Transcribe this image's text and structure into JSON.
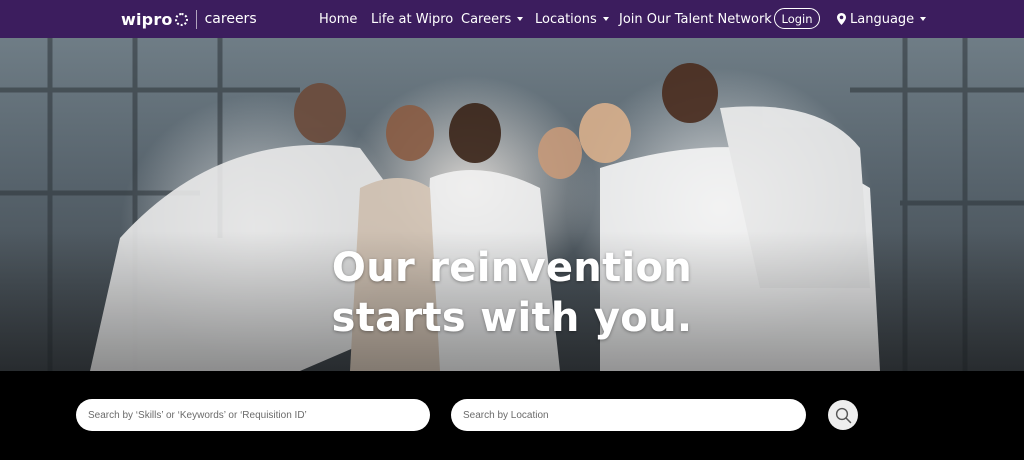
{
  "brand": {
    "logo_text": "wipro",
    "section": "careers"
  },
  "nav": {
    "home": "Home",
    "life": "Life at Wipro",
    "careers": "Careers",
    "locations": "Locations",
    "talent": "Join Our Talent Network",
    "login": "Login",
    "language": "Language"
  },
  "hero": {
    "line1": "Our reinvention",
    "line2": "starts with you."
  },
  "search": {
    "keywords_placeholder": "Search by ‘Skills’ or ‘Keywords’ or ‘Requisition ID’",
    "location_placeholder": "Search by Location",
    "button_icon": "search-icon"
  },
  "colors": {
    "nav_bg": "#3c1d5e",
    "search_band": "#000000"
  }
}
